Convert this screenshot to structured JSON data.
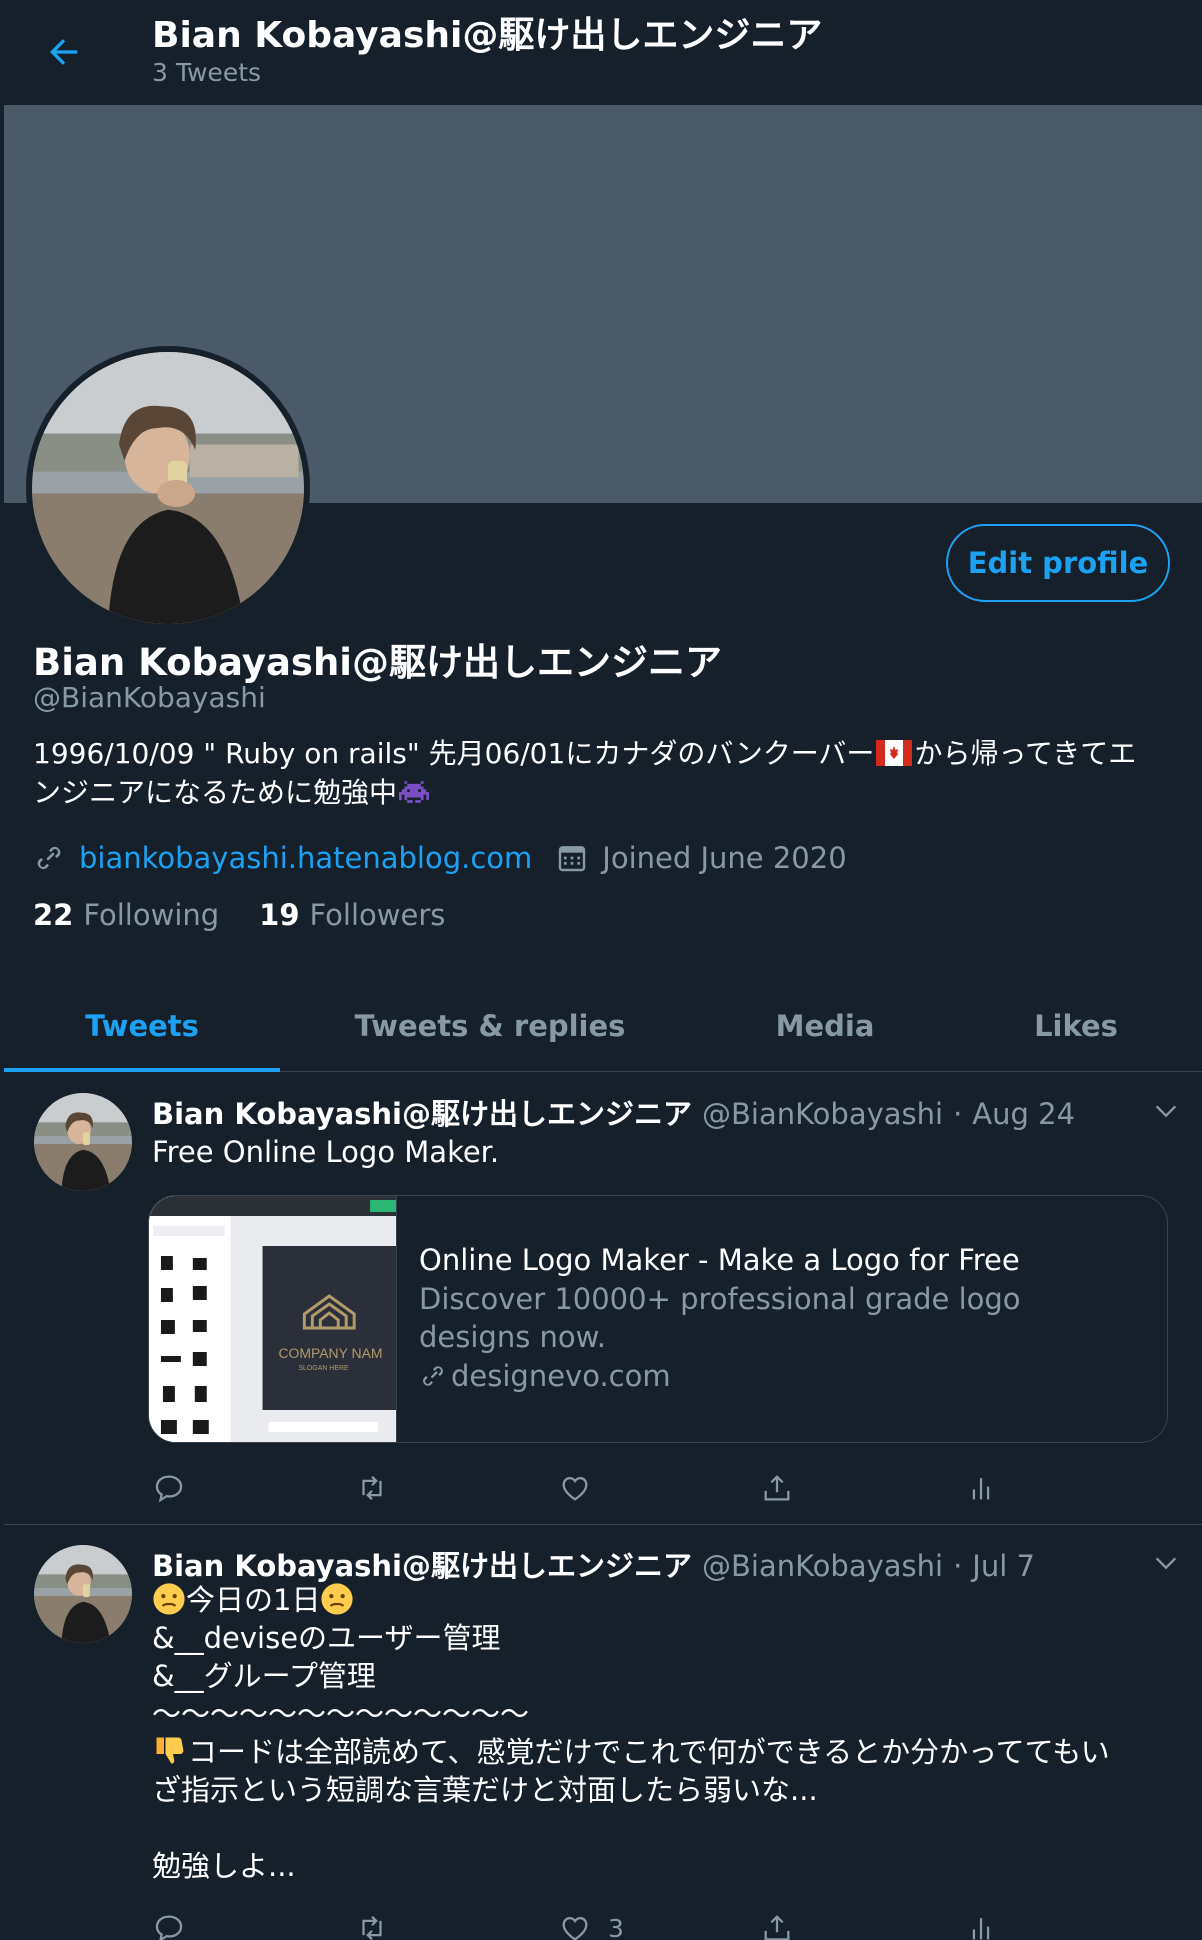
{
  "header": {
    "title": "Bian Kobayashi@駆け出しエンジニア",
    "tweet_count": "3 Tweets"
  },
  "profile": {
    "name": "Bian Kobayashi@駆け出しエンジニア",
    "handle": "@BianKobayashi",
    "edit_label": "Edit profile",
    "bio_line1_a": "1996/10/09 \" Ruby on rails\" 先月06/01にカナダのバンクーバー",
    "bio_line1_b": "から帰ってきてエ",
    "bio_line2": "ンジニアになるために勉強中",
    "website": "biankobayashi.hatenablog.com",
    "joined": "Joined June 2020",
    "following_count": "22",
    "following_label": "Following",
    "followers_count": "19",
    "followers_label": "Followers"
  },
  "tabs": [
    {
      "label": "Tweets",
      "active": true
    },
    {
      "label": "Tweets & replies",
      "active": false
    },
    {
      "label": "Media",
      "active": false
    },
    {
      "label": "Likes",
      "active": false
    }
  ],
  "tweets": [
    {
      "name": "Bian Kobayashi@駆け出しエンジニア",
      "handle": "@BianKobayashi",
      "separator": "·",
      "date": "Aug 24",
      "text": "Free Online Logo Maker.",
      "card": {
        "title": "Online Logo Maker - Make a Logo for Free",
        "description": "Discover 10000+ professional grade logo designs now.",
        "domain": "designevo.com",
        "thumb_text": "COMPANY NAM",
        "thumb_slogan": "SLOGAN HERE"
      },
      "likes": ""
    },
    {
      "name": "Bian Kobayashi@駆け出しエンジニア",
      "handle": "@BianKobayashi",
      "separator": "·",
      "date": "Jul 7",
      "line1": "今日の1日",
      "line2": "&__deviseのユーザー管理",
      "line3": "&__グループ管理",
      "line4": "〜〜〜〜〜〜〜〜〜〜〜〜〜",
      "line5": "コードは全部読めて、感覚だけでこれで何ができるとか分かっててもい",
      "line6": "ざ指示という短調な言葉だけと対面したら弱いな...",
      "line7": "",
      "line8": "勉強しよ...",
      "likes": "3"
    }
  ],
  "colors": {
    "background": "#15202b",
    "accent": "#1da1f2",
    "secondary_text": "#8899a6",
    "banner": "#4a5a69",
    "border": "#38444d"
  },
  "icons": [
    "back-arrow-icon",
    "link-icon",
    "calendar-icon",
    "chevron-down-icon",
    "reply-icon",
    "retweet-icon",
    "like-icon",
    "share-icon",
    "analytics-icon"
  ]
}
